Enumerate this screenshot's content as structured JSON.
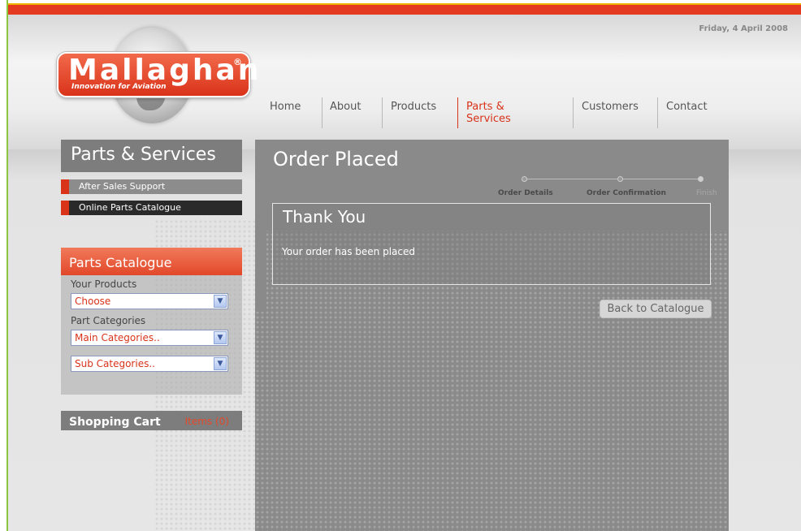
{
  "header": {
    "date": "Friday, 4 April 2008",
    "logo_text": "Mallaghan",
    "logo_registered": "®",
    "logo_tagline": "Innovation for Aviation"
  },
  "nav": {
    "items": [
      {
        "label": "Home"
      },
      {
        "label": "About"
      },
      {
        "label": "Products"
      },
      {
        "label": "Parts & Services",
        "active": true
      },
      {
        "label": "Customers"
      },
      {
        "label": "Contact"
      }
    ]
  },
  "sidebar": {
    "title": "Parts & Services",
    "links": [
      {
        "label": "After Sales Support"
      },
      {
        "label": "Online Parts Catalogue"
      }
    ],
    "parts_catalogue": {
      "title": "Parts Catalogue",
      "products_label": "Your Products",
      "products_select": "Choose",
      "categories_label": "Part Categories",
      "main_categories_select": "Main Categories..",
      "sub_categories_select": "Sub Categories.."
    },
    "cart": {
      "label": "Shopping Cart",
      "items": "Items (0)"
    }
  },
  "main": {
    "title": "Order Placed",
    "steps": [
      {
        "label": "Order Details"
      },
      {
        "label": "Order Confirmation"
      },
      {
        "label": "Finish"
      }
    ],
    "thanks_title": "Thank You",
    "thanks_message": "Your order has been placed",
    "back_button": "Back to Catalogue"
  },
  "colors": {
    "accent": "#d9331a",
    "topbar": "#e43a1f",
    "panel_gray": "#8a8a8a"
  }
}
